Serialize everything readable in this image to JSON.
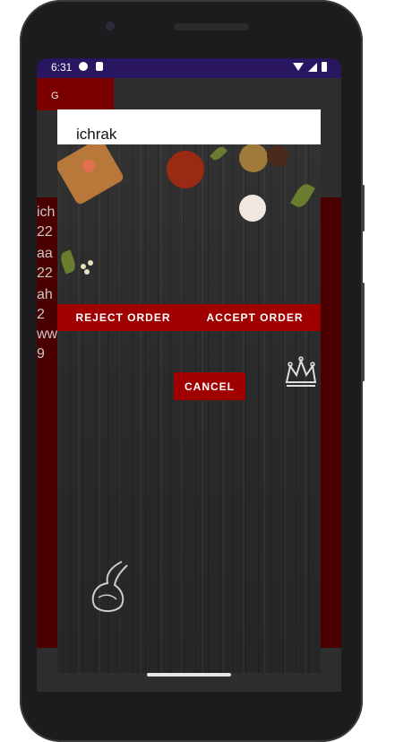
{
  "status_bar": {
    "time": "6:31",
    "left_icons": [
      "notification-icon",
      "sim-icon"
    ],
    "right_icons": [
      "wifi-icon",
      "signal-icon",
      "battery-icon"
    ]
  },
  "background_app": {
    "topbar_text": "G",
    "list_text": [
      "ich",
      "22",
      "aa",
      "22",
      "ah",
      "2",
      "ww",
      "9"
    ]
  },
  "dialog": {
    "name_value": "ichrak",
    "reject_label": "REJECT ORDER",
    "accept_label": "ACCEPT ORDER",
    "cancel_label": "CANCEL"
  },
  "colors": {
    "accent": "#a00000",
    "statusbar": "#2a1660"
  }
}
